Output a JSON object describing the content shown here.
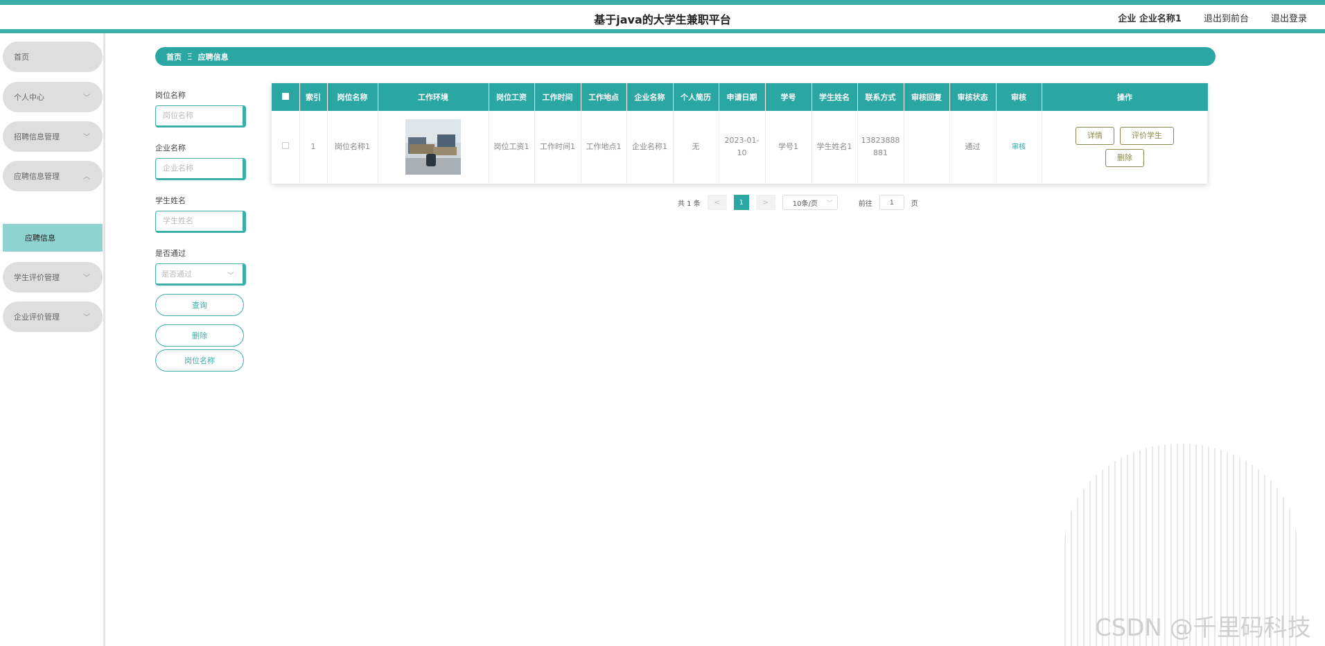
{
  "header": {
    "title": "基于java的大学生兼职平台",
    "user": "企业 企业名称1",
    "back_to_front": "退出到前台",
    "logout": "退出登录"
  },
  "sidebar": {
    "items": [
      {
        "label": "首页"
      },
      {
        "label": "个人中心"
      },
      {
        "label": "招聘信息管理"
      },
      {
        "label": "应聘信息管理"
      },
      {
        "label": "学生评价管理"
      },
      {
        "label": "企业评价管理"
      }
    ],
    "active_sub": "应聘信息"
  },
  "breadcrumb": {
    "home": "首页",
    "sep": "Ξ",
    "current": "应聘信息"
  },
  "search": {
    "job_label": "岗位名称",
    "job_placeholder": "岗位名称",
    "company_label": "企业名称",
    "company_placeholder": "企业名称",
    "student_label": "学生姓名",
    "student_placeholder": "学生姓名",
    "pass_label": "是否通过",
    "pass_placeholder": "是否通过",
    "query_btn": "查询",
    "delete_btn": "删除",
    "job_btn": "岗位名称"
  },
  "table": {
    "headers": [
      "索引",
      "岗位名称",
      "工作环境",
      "岗位工资",
      "工作时间",
      "工作地点",
      "企业名称",
      "个人简历",
      "申请日期",
      "学号",
      "学生姓名",
      "联系方式",
      "审核回复",
      "审核状态",
      "审核",
      "操作"
    ],
    "rows": [
      {
        "index": "1",
        "job": "岗位名称1",
        "env_image": "office-cubicle-photo",
        "salary": "岗位工资1",
        "time": "工作时间1",
        "place": "工作地点1",
        "company": "企业名称1",
        "resume": "无",
        "date": "2023-01-10",
        "sno": "学号1",
        "sname": "学生姓名1",
        "phone": "13823888881",
        "reply": "",
        "status": "通过",
        "audit_link": "审核",
        "op_detail": "详情",
        "op_eval": "评价学生",
        "op_delete": "删除"
      }
    ]
  },
  "pager": {
    "total": "共 1 条",
    "prev": "<",
    "page": "1",
    "next": ">",
    "size": "10条/页",
    "goto_label": "前往",
    "goto_value": "1",
    "page_unit": "页"
  },
  "watermark": "CSDN @千里码科技",
  "colors": {
    "accent": "#2aa7a3",
    "sidebar_item": "#dedede",
    "sidebar_active": "#8fd3d0"
  }
}
